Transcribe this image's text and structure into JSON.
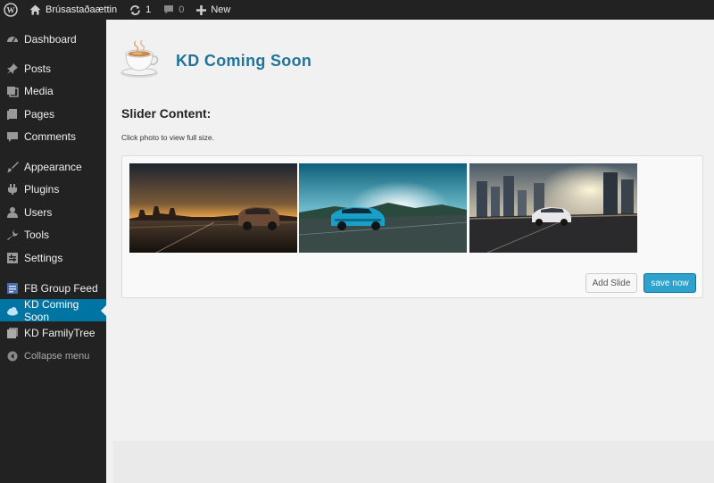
{
  "admin_bar": {
    "site_name": "Brúsastaðaættin",
    "updates_count": "1",
    "comments_count": "0",
    "new_label": "New"
  },
  "sidebar": {
    "items": [
      {
        "label": "Dashboard",
        "icon": "dashboard-icon"
      },
      {
        "label": "Posts",
        "icon": "pin-icon"
      },
      {
        "label": "Media",
        "icon": "media-icon"
      },
      {
        "label": "Pages",
        "icon": "pages-icon"
      },
      {
        "label": "Comments",
        "icon": "comment-icon"
      },
      {
        "label": "Appearance",
        "icon": "brush-icon"
      },
      {
        "label": "Plugins",
        "icon": "plug-icon"
      },
      {
        "label": "Users",
        "icon": "user-icon"
      },
      {
        "label": "Tools",
        "icon": "wrench-icon"
      },
      {
        "label": "Settings",
        "icon": "settings-icon"
      },
      {
        "label": "FB Group Feed",
        "icon": "fb-feed-icon"
      },
      {
        "label": "KD Coming Soon",
        "icon": "cloud-icon"
      },
      {
        "label": "KD FamilyTree",
        "icon": "familytree-icon"
      }
    ],
    "collapse_label": "Collapse menu"
  },
  "main": {
    "plugin_title": "KD Coming Soon",
    "section_heading": "Slider Content:",
    "section_note": "Click photo to view full size.",
    "add_slide_label": "Add Slide",
    "save_label": "save now"
  },
  "colors": {
    "accent": "#0074a2",
    "title": "#21759b",
    "button": "#2ea2cc"
  }
}
